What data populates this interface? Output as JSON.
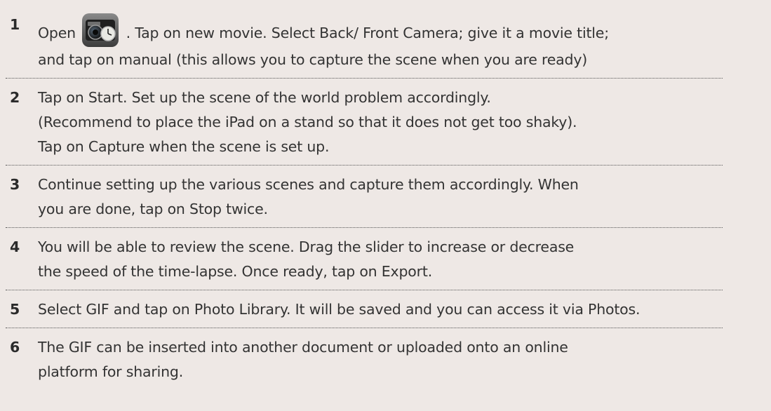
{
  "steps": [
    {
      "number": "1",
      "lines": [
        {
          "before_icon": "Open ",
          "after_icon": " . Tap on new movie. Select Back/ Front Camera; give it a movie title;"
        },
        "and tap on manual (this allows you to capture the scene when you are ready)"
      ],
      "icon": "camera-clock-app-icon"
    },
    {
      "number": "2",
      "lines": [
        "Tap on Start. Set up the scene of the world problem accordingly.",
        "(Recommend to place the iPad on a stand so that it does not get too shaky).",
        "Tap on Capture when the scene is set up."
      ]
    },
    {
      "number": "3",
      "lines": [
        "Continue setting up the various scenes and capture them accordingly. When",
        "you are done, tap on Stop twice."
      ]
    },
    {
      "number": "4",
      "lines": [
        "You will be able to review the scene. Drag the slider to increase or decrease",
        "the speed of the time-lapse. Once ready, tap on Export."
      ]
    },
    {
      "number": "5",
      "lines": [
        "Select GIF and tap on Photo Library. It will be saved and you can access it via Photos."
      ]
    },
    {
      "number": "6",
      "lines": [
        "The GIF can be inserted into another document or uploaded onto an online",
        "platform for sharing."
      ]
    }
  ]
}
